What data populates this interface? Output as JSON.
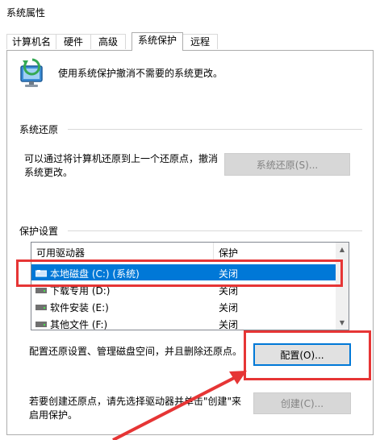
{
  "window": {
    "title": "系统属性"
  },
  "tabs": [
    {
      "label": "计算机名"
    },
    {
      "label": "硬件"
    },
    {
      "label": "高级"
    },
    {
      "label": "系统保护"
    },
    {
      "label": "远程"
    }
  ],
  "intro": {
    "text": "使用系统保护撤消不需要的系统更改。"
  },
  "restore": {
    "section_title": "系统还原",
    "desc_line1": "可以通过将计算机还原到上一个还原点，撤消",
    "desc_line2": "系统更改。",
    "button_label": "系统还原(S)..."
  },
  "protection": {
    "section_title": "保护设置",
    "columns": {
      "drive": "可用驱动器",
      "status": "保护"
    },
    "drives": [
      {
        "name": "本地磁盘 (C:) (系统)",
        "status": "关闭"
      },
      {
        "name": "下载专用 (D:)",
        "status": "关闭"
      },
      {
        "name": "软件安装 (E:)",
        "status": "关闭"
      },
      {
        "name": "其他文件 (F:)",
        "status": "关闭"
      }
    ],
    "configure_text": "配置还原设置、管理磁盘空间，并且删除还原点。",
    "configure_button": "配置(O)...",
    "create_line1": "若要创建还原点，请先选择驱动器并单击\"创建\"来",
    "create_line2": "启用保护。",
    "create_button": "创建(C)..."
  },
  "colors": {
    "selection": "#0078d7",
    "annotation": "#e63535"
  }
}
